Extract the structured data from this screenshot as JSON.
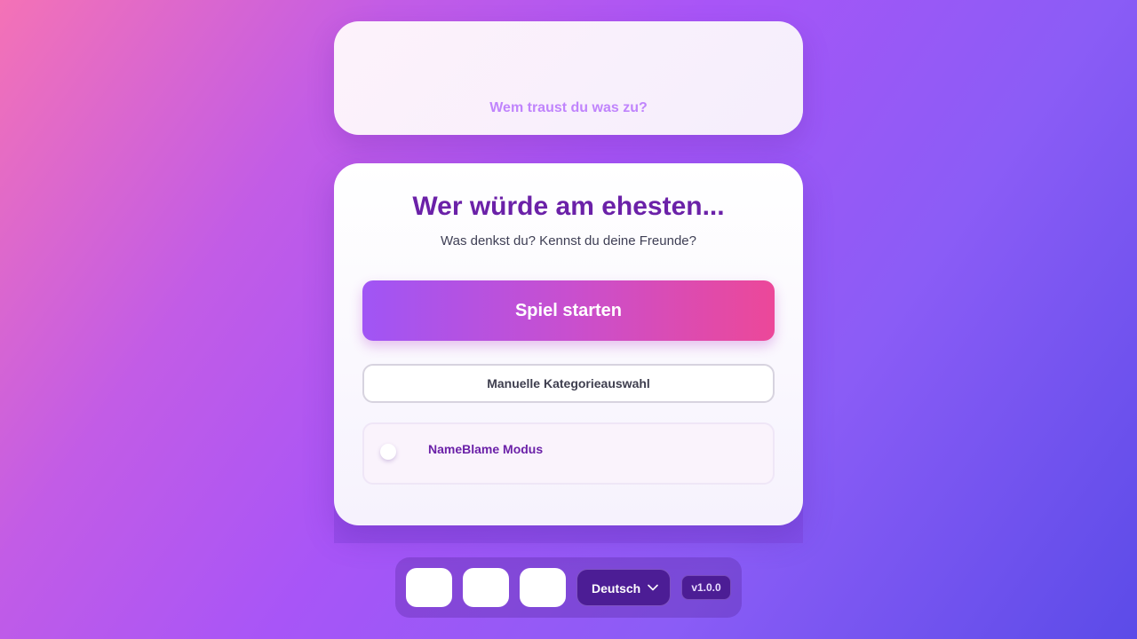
{
  "header": {
    "tagline": "Wem traust du was zu?"
  },
  "main": {
    "title": "Wer würde am ehesten...",
    "subtitle": "Was denkst du? Kennst du deine Freunde?",
    "start_button": "Spiel starten",
    "manual_button": "Manuelle Kategorieauswahl",
    "mode_toggle": {
      "label": "NameBlame Modus",
      "enabled": false
    }
  },
  "footer": {
    "language_selected": "Deutsch",
    "version": "v1.0.0"
  },
  "colors": {
    "accent_purple": "#6b21a8",
    "gradient_start": "#a055f5",
    "gradient_end": "#ec4899",
    "tagline": "#c084fc",
    "dark_chip": "#4c1d95"
  },
  "icons": {
    "language_dropdown": "chevron-down-icon"
  }
}
